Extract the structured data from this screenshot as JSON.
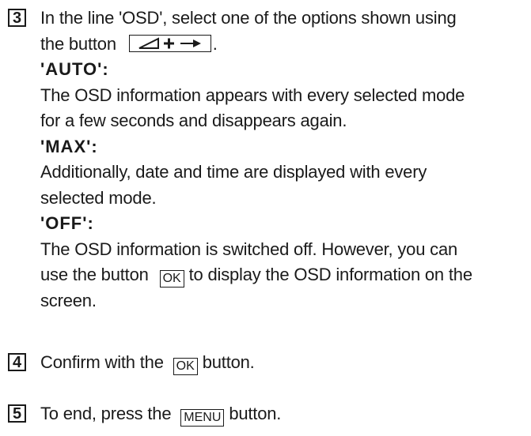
{
  "steps": [
    {
      "number": "3",
      "lines": {
        "l1": "In the line 'OSD', select one of the options shown using",
        "l2_before": "the button",
        "l2_after": ".",
        "auto_label": "'AUTO':",
        "auto_1": "The OSD information appears with every selected mode",
        "auto_2": "for a few seconds and disappears again.",
        "max_label": "'MAX':",
        "max_1": "Additionally, date and time are displayed with every",
        "max_2": "selected mode.",
        "off_label": "'OFF':",
        "off_1": "The OSD information is switched off. However, you can",
        "off_2_before": "use the button",
        "off_2_after": "to display the OSD information on the",
        "off_3": "screen."
      },
      "nav_key_icon": "volume-plus-right-arrow-icon"
    },
    {
      "number": "4",
      "before": "Confirm with the",
      "key": "OK",
      "after": "button."
    },
    {
      "number": "5",
      "before": "To end, press the",
      "key": "MENU",
      "after": "button."
    }
  ],
  "keys": {
    "ok": "OK"
  }
}
